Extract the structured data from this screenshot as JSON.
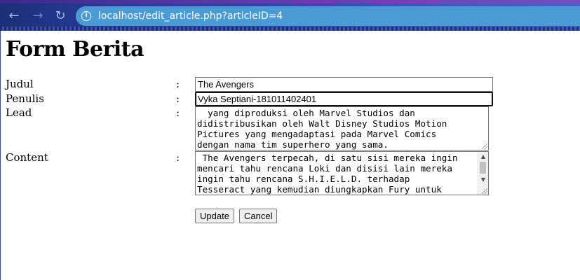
{
  "browser": {
    "url": "localhost/edit_article.php?articleID=4",
    "back_icon": "arrow-left-icon",
    "forward_icon": "arrow-right-icon",
    "reload_icon": "reload-icon",
    "info_icon": "info-icon",
    "accent_color": "#4a9ad4"
  },
  "page": {
    "title": "Form Berita"
  },
  "form": {
    "separator": ":",
    "judul": {
      "label": "Judul",
      "value": "The Avengers"
    },
    "penulis": {
      "label": "Penulis",
      "value": "Vyka Septiani-181011402401"
    },
    "lead": {
      "label": "Lead",
      "lines": [
        "  yang diproduksi oleh Marvel Studios dan",
        "didistribusikan oleh Walt Disney Studios Motion",
        "Pictures yang mengadaptasi pada Marvel Comics",
        "dengan nama tim superhero yang sama."
      ]
    },
    "content": {
      "label": "Content",
      "lines": [
        " The Avengers terpecah, di satu sisi mereka ingin",
        "mencari tahu rencana Loki dan disisi lain mereka",
        "ingin tahu rencana S.H.I.E.L.D. terhadap",
        "Tesseract yang kemudian diungkapkan Fury untuk"
      ]
    },
    "update_label": "Update",
    "cancel_label": "Cancel"
  }
}
